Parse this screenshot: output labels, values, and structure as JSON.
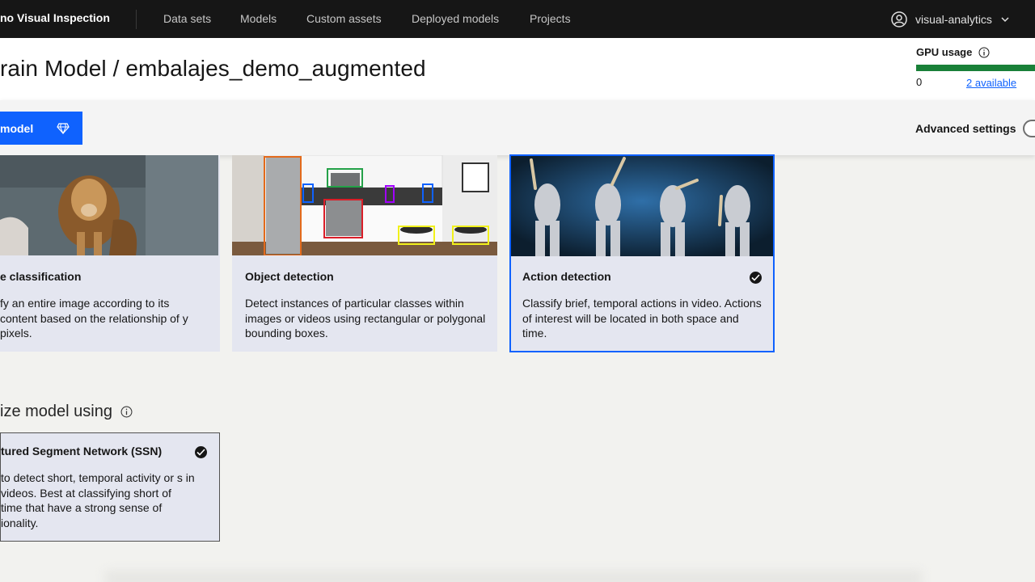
{
  "nav": {
    "brand": "no Visual Inspection",
    "links": [
      "Data sets",
      "Models",
      "Custom assets",
      "Deployed models",
      "Projects"
    ],
    "user": "visual-analytics"
  },
  "header": {
    "title": "rain Model / embalajes_demo_augmented",
    "gpu_label": "GPU usage",
    "gpu_used": "0",
    "gpu_available": "2 available",
    "gpu_fill_fraction": 1.0
  },
  "toolbar": {
    "train_label": "model",
    "advanced_label": "Advanced settings"
  },
  "cards": [
    {
      "title": "e classification",
      "desc": "fy an entire image according to its content based on the relationship of y pixels.",
      "selected": false
    },
    {
      "title": "Object detection",
      "desc": "Detect instances of particular classes within images or videos using rectangular or polygonal bounding boxes.",
      "selected": false
    },
    {
      "title": "Action detection",
      "desc": "Classify brief, temporal actions in video. Actions of interest will be located in both space and time.",
      "selected": true
    }
  ],
  "optimize": {
    "label": "ize model using",
    "option_title": "tured Segment Network (SSN)",
    "option_desc": "to detect short, temporal activity or s in videos. Best at classifying short of time that have a strong sense of ionality."
  },
  "colors": {
    "accent": "#0f62fe",
    "gpu_bar": "#198038",
    "nav_bg": "#161616",
    "card_bg": "#e4e6f0"
  }
}
